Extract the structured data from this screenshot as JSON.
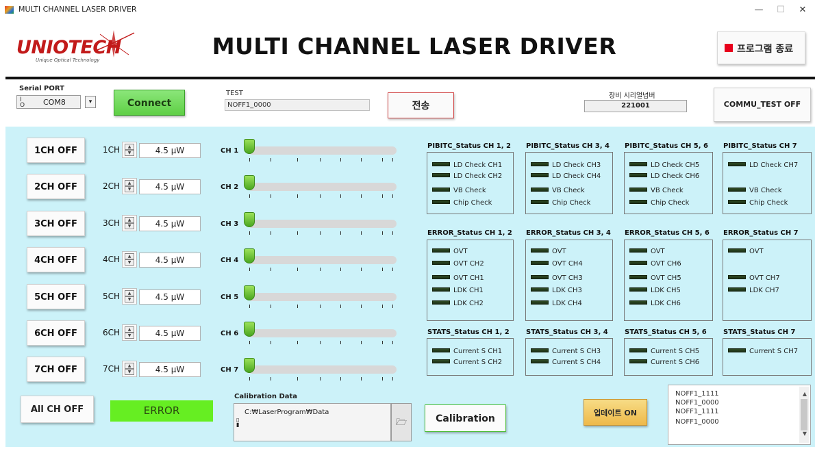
{
  "window": {
    "title": "MULTI CHANNEL LASER DRIVER",
    "min": "—",
    "max": "☐",
    "close": "✕"
  },
  "header": {
    "logo_text": "UNIOTECH",
    "logo_tagline": "Unique Optical Technology",
    "title": "MULTI CHANNEL LASER DRIVER",
    "exit_label": "프로그램 종료",
    "exit_color": "#e8001c"
  },
  "serial": {
    "label": "Serial PORT",
    "value": "COM8",
    "connect_label": "Connect"
  },
  "test": {
    "label": "TEST",
    "value": "NOFF1_0000",
    "send_label": "전송"
  },
  "device_serial": {
    "label": "장비 시리얼넘버",
    "value": "221001"
  },
  "commu_test_label": "COMMU_TEST OFF",
  "channels": [
    {
      "button": "1CH OFF",
      "label": "1CH",
      "power": "4.5 μW",
      "slider_label": "CH 1",
      "level": 0
    },
    {
      "button": "2CH OFF",
      "label": "2CH",
      "power": "4.5 μW",
      "slider_label": "CH 2",
      "level": 0
    },
    {
      "button": "3CH OFF",
      "label": "3CH",
      "power": "4.5 μW",
      "slider_label": "CH 3",
      "level": 0
    },
    {
      "button": "4CH OFF",
      "label": "4CH",
      "power": "4.5 μW",
      "slider_label": "CH 4",
      "level": 0
    },
    {
      "button": "5CH OFF",
      "label": "5CH",
      "power": "4.5 μW",
      "slider_label": "CH 5",
      "level": 0
    },
    {
      "button": "6CH OFF",
      "label": "6CH",
      "power": "4.5 μW",
      "slider_label": "CH 6",
      "level": 0
    },
    {
      "button": "7CH OFF",
      "label": "7CH",
      "power": "4.5 μW",
      "slider_label": "CH 7",
      "level": 0
    }
  ],
  "all_off_label": "All CH OFF",
  "error_indicator": "ERROR",
  "calibration": {
    "label": "Calibration Data",
    "path": "C:₩LaserProgram₩Data",
    "button": "Calibration"
  },
  "update_label": "업데이트 ON",
  "log_lines": [
    "NOFF1_1111",
    "NOFF1_0000",
    "NOFF1_1111",
    "NOFF1_0000"
  ],
  "status": {
    "pibitc": [
      {
        "title": "PIBITC_Status CH 1, 2",
        "leds": [
          "LD Check CH1",
          "LD Check CH2",
          "VB Check",
          "Chip Check"
        ]
      },
      {
        "title": "PIBITC_Status CH 3, 4",
        "leds": [
          "LD Check CH3",
          "LD Check CH4",
          "VB Check",
          "Chip Check"
        ]
      },
      {
        "title": "PIBITC_Status CH 5, 6",
        "leds": [
          "LD Check CH5",
          "LD Check CH6",
          "VB Check",
          "Chip Check"
        ]
      },
      {
        "title": "PIBITC_Status CH 7",
        "leds": [
          "LD Check CH7",
          "",
          "VB Check",
          "Chip Check"
        ]
      }
    ],
    "error": [
      {
        "title": "ERROR_Status CH 1, 2",
        "leds": [
          "OVT",
          "OVT CH2",
          "OVT CH1",
          "LDK CH1",
          "LDK CH2"
        ]
      },
      {
        "title": "ERROR_Status CH 3, 4",
        "leds": [
          "OVT",
          "OVT CH4",
          "OVT CH3",
          "LDK CH3",
          "LDK CH4"
        ]
      },
      {
        "title": "ERROR_Status CH 5, 6",
        "leds": [
          "OVT",
          "OVT CH6",
          "OVT CH5",
          "LDK CH5",
          "LDK CH6"
        ]
      },
      {
        "title": "ERROR_Status CH 7",
        "leds": [
          "OVT",
          "",
          "OVT CH7",
          "LDK CH7",
          ""
        ]
      }
    ],
    "stats": [
      {
        "title": "STATS_Status CH 1, 2",
        "leds": [
          "Current S CH1",
          "Current S CH2"
        ]
      },
      {
        "title": "STATS_Status CH 3, 4",
        "leds": [
          "Current S CH3",
          "Current S CH4"
        ]
      },
      {
        "title": "STATS_Status CH 5, 6",
        "leds": [
          "Current S CH5",
          "Current S CH6"
        ]
      },
      {
        "title": "STATS_Status CH 7",
        "leds": [
          "Current S CH7"
        ]
      }
    ]
  },
  "colors": {
    "panel": "#ccf2f9",
    "error_indicator": "#66ee22",
    "led_off": "#2f4a24",
    "knob": "#6cc232"
  },
  "icons": {
    "folder": "folder-icon",
    "io": "visa-io-icon",
    "dropdown": "dropdown-arrow-icon"
  }
}
